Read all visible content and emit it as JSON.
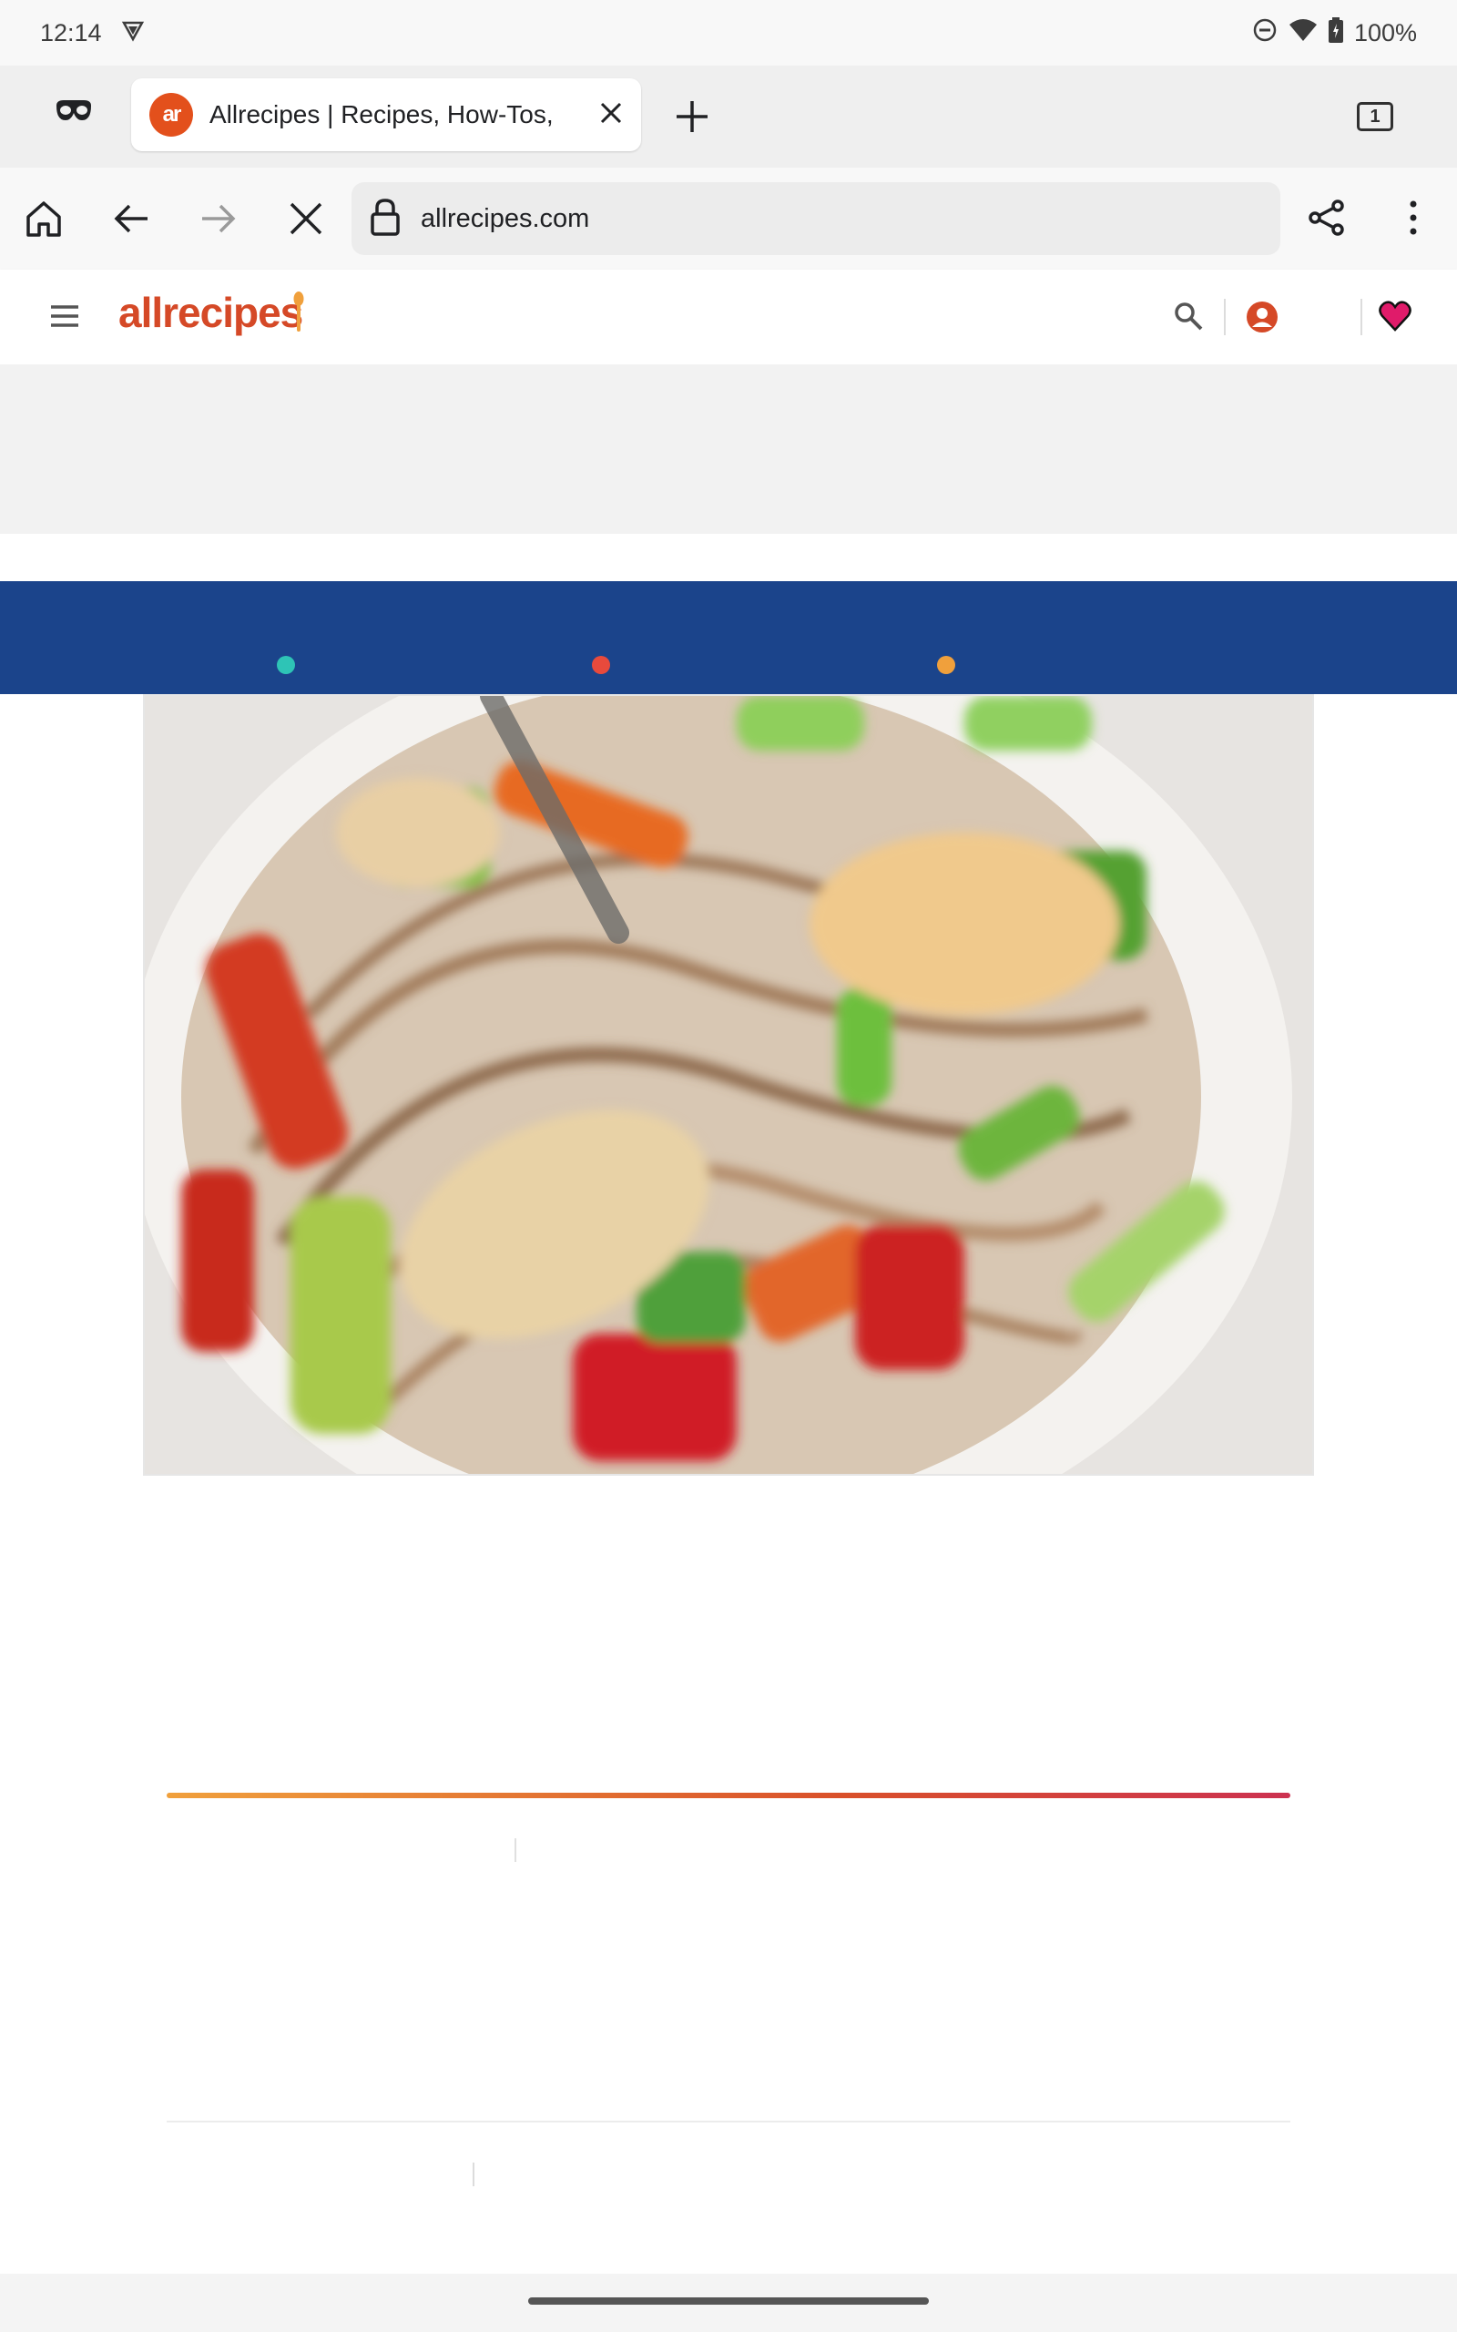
{
  "status_bar": {
    "time": "12:14",
    "battery": "100%"
  },
  "browser": {
    "tab_title": "Allrecipes | Recipes, How-Tos,",
    "favicon_text": "ar",
    "tab_count": "1",
    "url": "allrecipes.com"
  },
  "site": {
    "logo_text": "allrecipes",
    "brand_color": "#d54927",
    "band_color": "#1b448b",
    "dots": [
      "#2ec4b6",
      "#e84a3c",
      "#f0a03c"
    ]
  },
  "icons": [
    "signal-icon",
    "dnd-icon",
    "wifi-icon",
    "battery-icon",
    "incognito-icon",
    "close-icon",
    "plus-icon",
    "home-icon",
    "back-icon",
    "forward-icon",
    "stop-icon",
    "lock-icon",
    "share-icon",
    "more-icon",
    "menu-icon",
    "search-icon",
    "account-icon",
    "heart-icon"
  ]
}
